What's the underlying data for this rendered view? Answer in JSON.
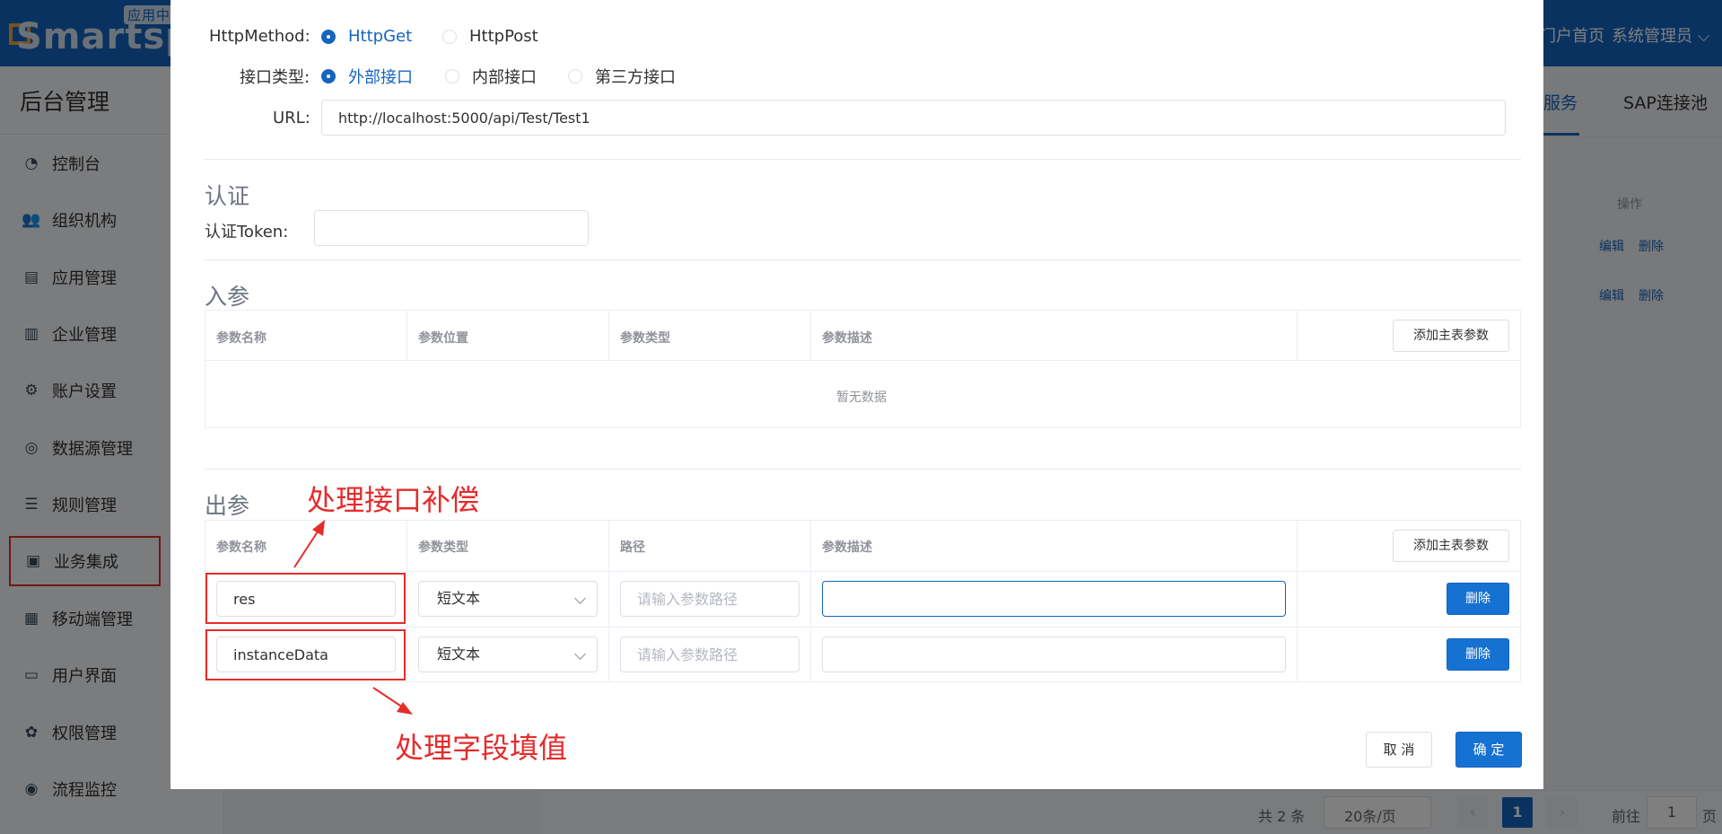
{
  "app": {
    "logo_text": "Smartspac",
    "logo_tag": "应用中",
    "top_home": "门户首页",
    "top_user": "系统管理员",
    "sidebar_title": "后台管理"
  },
  "sidebar": {
    "items": [
      {
        "label": "控制台",
        "icon": "◔"
      },
      {
        "label": "组织机构",
        "icon": "👥"
      },
      {
        "label": "应用管理",
        "icon": "▤"
      },
      {
        "label": "企业管理",
        "icon": "▥"
      },
      {
        "label": "账户设置",
        "icon": "⚙"
      },
      {
        "label": "数据源管理",
        "icon": "◎"
      },
      {
        "label": "规则管理",
        "icon": "☰"
      },
      {
        "label": "业务集成",
        "icon": "▣"
      },
      {
        "label": "移动端管理",
        "icon": "▦"
      },
      {
        "label": "用户界面",
        "icon": "▭"
      },
      {
        "label": "权限管理",
        "icon": "✿"
      },
      {
        "label": "流程监控",
        "icon": "◉"
      }
    ]
  },
  "bg_tabs": {
    "service": "服务",
    "sap": "SAP连接池"
  },
  "bg_table": {
    "op_header": "操作",
    "edit": "编辑",
    "delete": "删除"
  },
  "pagination": {
    "total": "共 2 条",
    "page_size": "20条/页",
    "prev": "‹",
    "current": "1",
    "next": "›",
    "goto": "前往",
    "goto_value": "1",
    "page_suffix": "页"
  },
  "dialog": {
    "http_method_label": "HttpMethod:",
    "http_get": "HttpGet",
    "http_post": "HttpPost",
    "api_type_label": "接口类型:",
    "api_types": [
      "外部接口",
      "内部接口",
      "第三方接口"
    ],
    "url_label": "URL:",
    "url_value": "http://localhost:5000/api/Test/Test1",
    "auth_title": "认证",
    "auth_token_label": "认证Token:",
    "auth_token_value": "",
    "input_params": {
      "title": "入参",
      "headers": [
        "参数名称",
        "参数位置",
        "参数类型",
        "参数描述"
      ],
      "add_button": "添加主表参数",
      "empty_text": "暂无数据"
    },
    "output_params": {
      "title": "出参",
      "headers": [
        "参数名称",
        "参数类型",
        "路径",
        "参数描述"
      ],
      "add_button": "添加主表参数",
      "path_placeholder": "请输入参数路径",
      "delete_button": "删除",
      "rows": [
        {
          "name": "res",
          "type": "短文本",
          "path": "",
          "desc": ""
        },
        {
          "name": "instanceData",
          "type": "短文本",
          "path": "",
          "desc": ""
        }
      ]
    },
    "cancel_button": "取 消",
    "confirm_button": "确 定"
  },
  "annotations": {
    "top": "处理接口补偿",
    "bottom": "处理字段填值",
    "color": "#e62b2b"
  }
}
